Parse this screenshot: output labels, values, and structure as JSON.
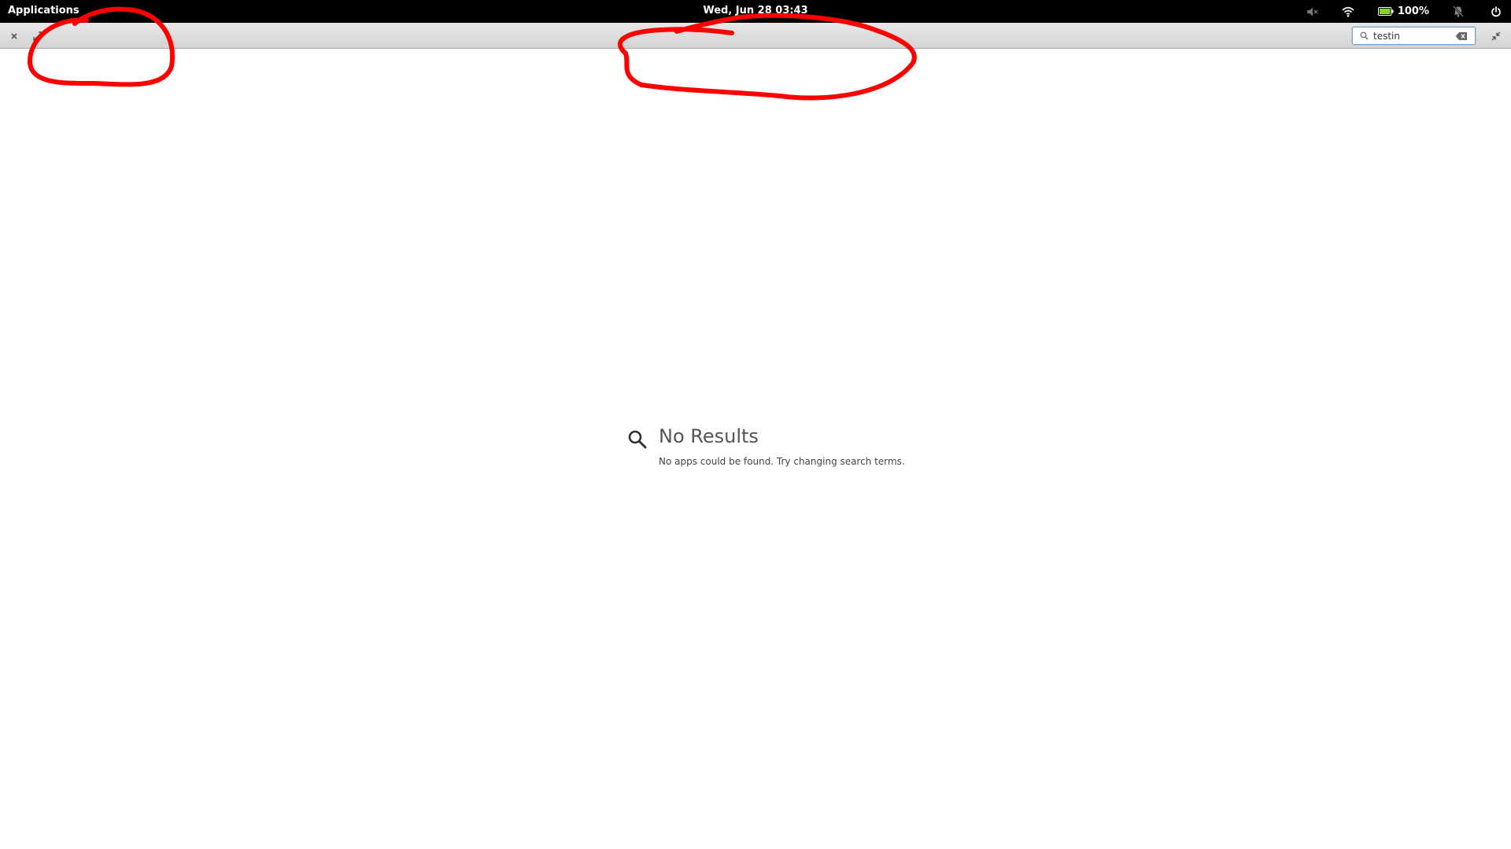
{
  "panel": {
    "apps_label": "Applications",
    "clock": "Wed, Jun 28   03:43",
    "battery_percent": "100%",
    "icons": [
      "volume-muted-icon",
      "wifi-icon",
      "battery-icon",
      "notifications-off-icon",
      "power-icon"
    ],
    "battery_color": "#8bd430"
  },
  "headerbar": {
    "search_value": "testin",
    "buttons": [
      "close-icon",
      "maximize-icon"
    ]
  },
  "main": {
    "title": "No Results",
    "description": "No apps could be found. Try changing search terms.",
    "icon": "search-icon"
  },
  "annotation_color": "#ff0000"
}
